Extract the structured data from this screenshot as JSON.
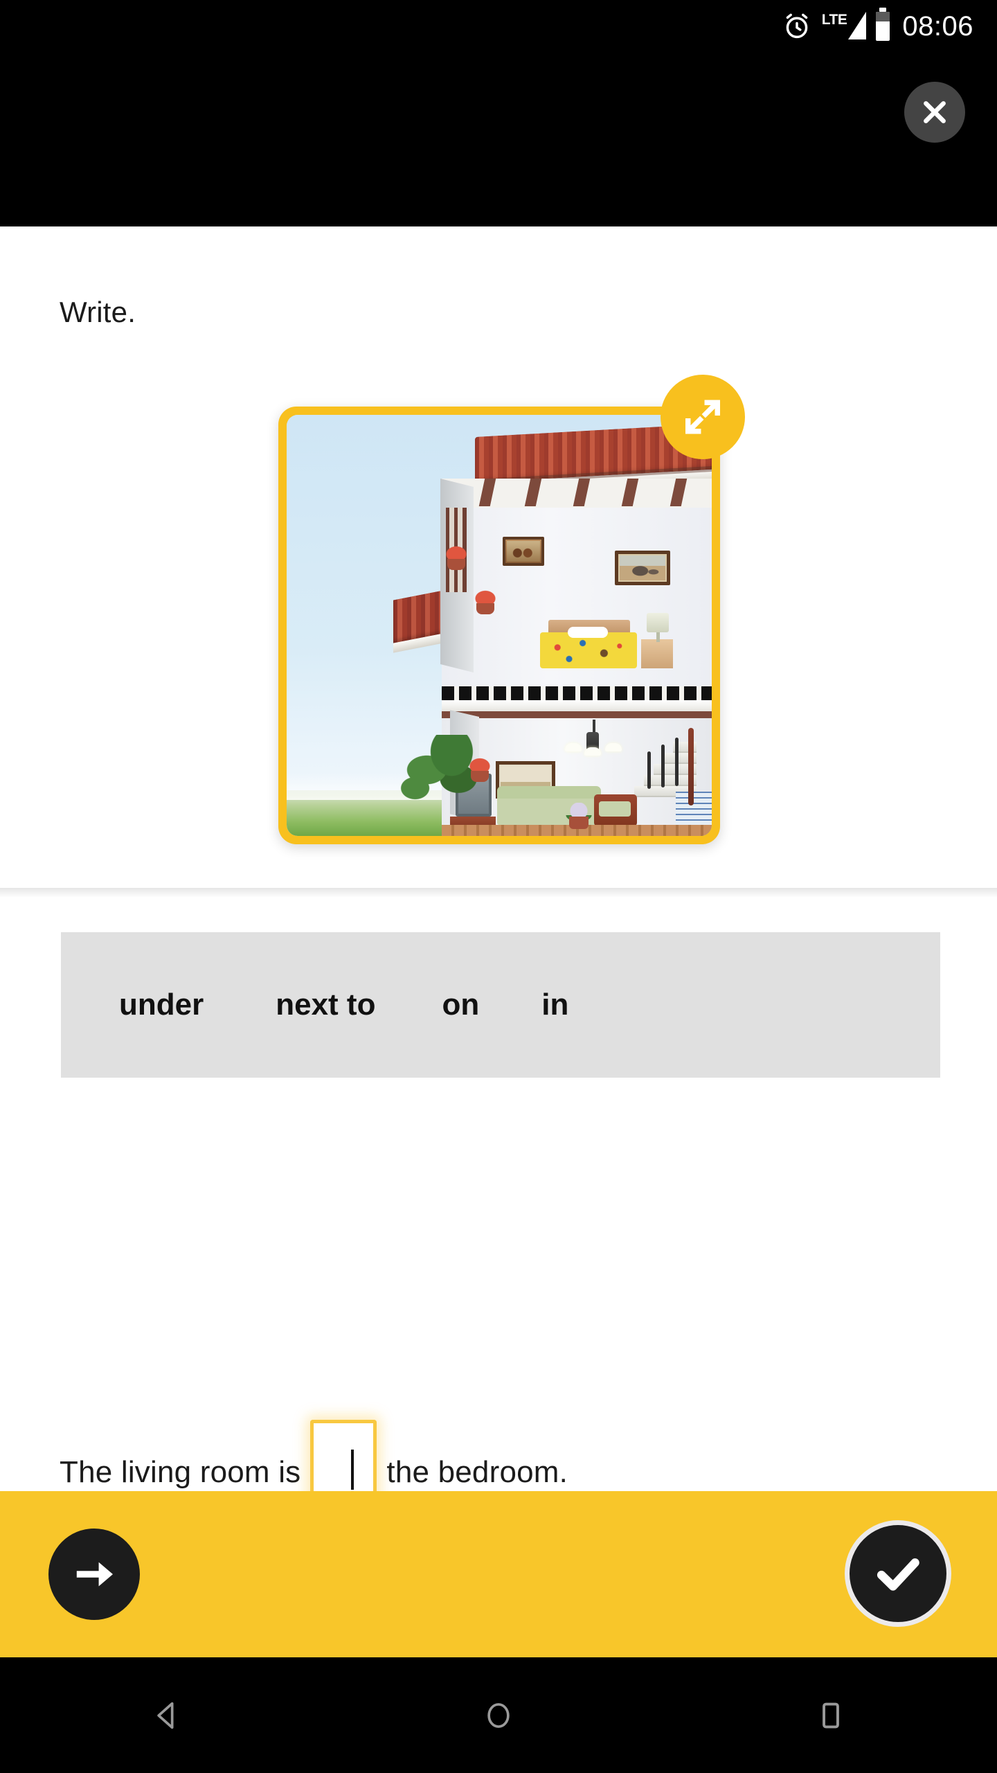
{
  "statusbar": {
    "time": "08:06",
    "network_label": "LTE",
    "icons": [
      "alarm-icon",
      "lte-signal-icon",
      "battery-icon"
    ]
  },
  "header": {
    "close_label": "✕",
    "close_icon": "close-icon"
  },
  "exercise": {
    "instruction": "Write.",
    "image": {
      "alt": "cutaway-house-illustration",
      "expand_icon": "expand-icon",
      "border_color": "#F8C01E",
      "description": "Two-storey house cutaway: upstairs bedroom with yellow bed and framed pictures, downstairs living room with sofa, armchair, chandelier, TV and staircase"
    },
    "word_bank": {
      "background_color": "#E0E0E0",
      "words": [
        "under",
        "next to",
        "on",
        "in"
      ]
    },
    "sentence": {
      "before": "The living room is",
      "after": "the bedroom.",
      "input_value": "",
      "input_placeholder": "",
      "input_focus_color": "#F8C840",
      "caret_visible": true
    }
  },
  "footer": {
    "background_color": "#F8C62A",
    "next_icon": "arrow-right-icon",
    "check_icon": "check-icon",
    "next_label": "Next",
    "check_label": "Check"
  },
  "navbar": {
    "back_icon": "triangle-back-icon",
    "home_icon": "circle-home-icon",
    "recents_icon": "square-recents-icon"
  }
}
